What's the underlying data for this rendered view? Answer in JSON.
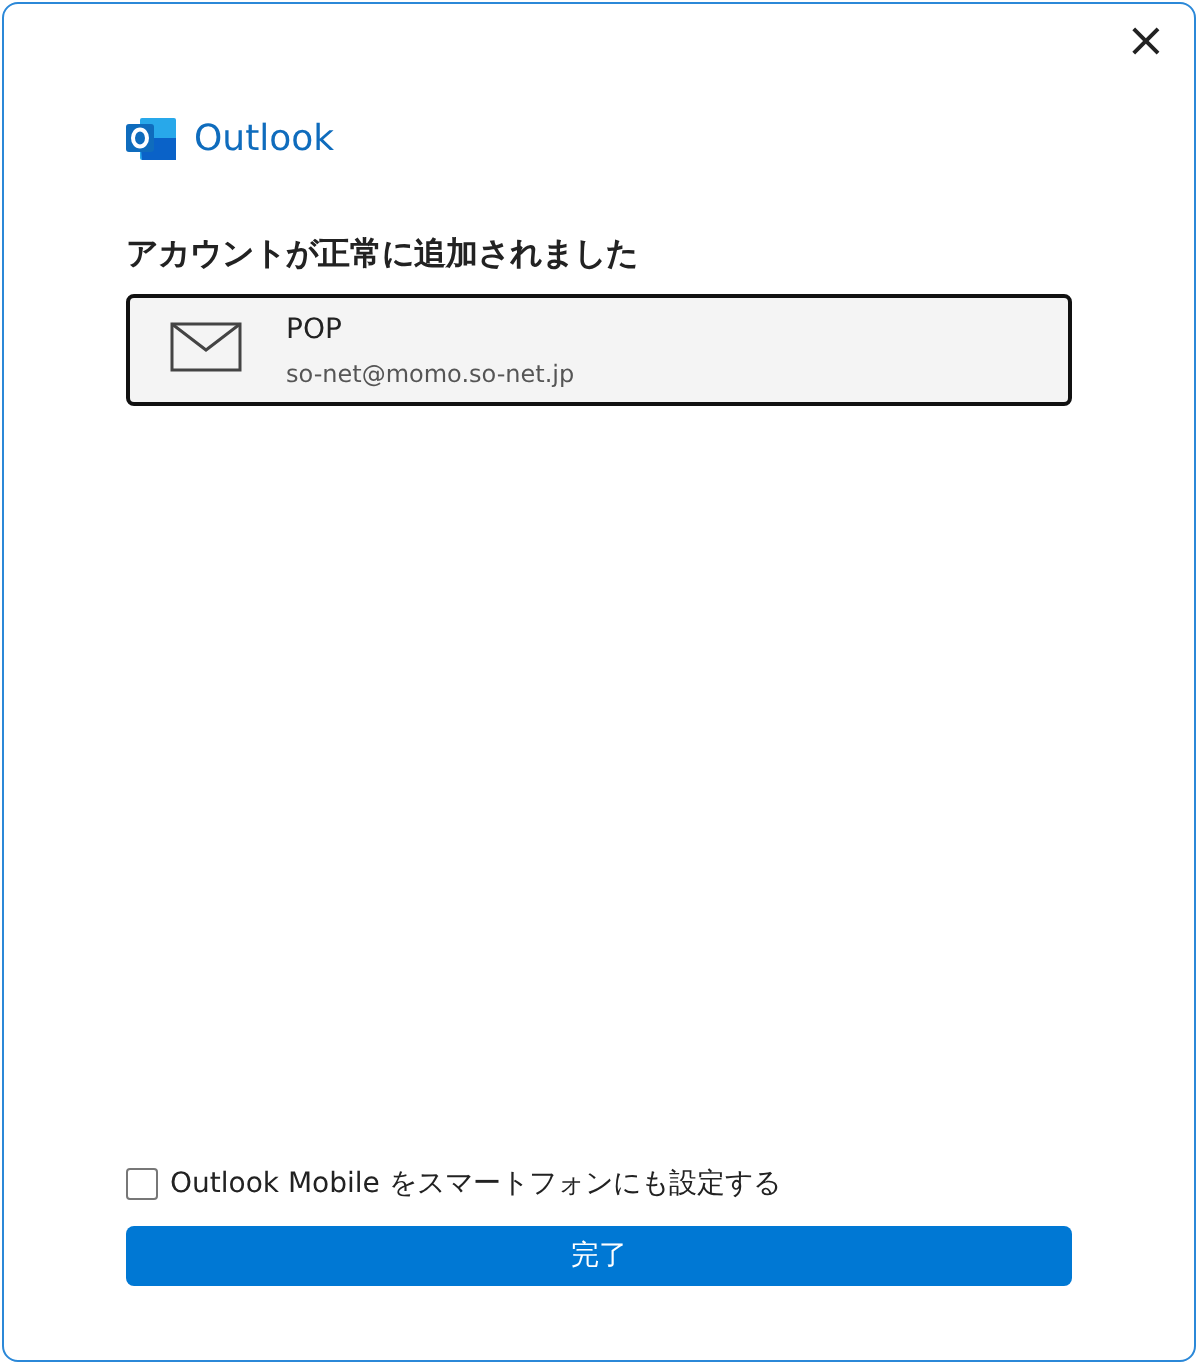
{
  "window": {
    "close": "×"
  },
  "app": {
    "name": "Outlook"
  },
  "heading": "アカウントが正常に追加されました",
  "account": {
    "type": "POP",
    "email": "so-net@momo.so-net.jp"
  },
  "mobile_option": {
    "label": "Outlook Mobile をスマートフォンにも設定する",
    "checked": false
  },
  "buttons": [
    "完了"
  ]
}
